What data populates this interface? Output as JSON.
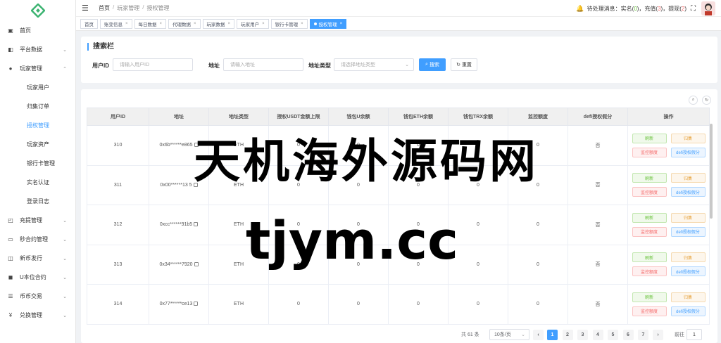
{
  "sidebar": {
    "items": [
      {
        "label": "首页",
        "icon": "dashboard-icon",
        "glyph": "▣"
      },
      {
        "label": "平台数据",
        "icon": "data-icon",
        "glyph": "◧",
        "chevron": "⌄"
      },
      {
        "label": "玩家管理",
        "icon": "user-icon",
        "glyph": "●",
        "chevron": "⌃"
      }
    ],
    "sub_items": [
      "玩家用户",
      "归集订单",
      "授权管理",
      "玩家资产",
      "银行卡管理",
      "实名认证",
      "登录日志"
    ],
    "bottom_items": [
      {
        "label": "充提管理",
        "icon": "wallet-icon",
        "glyph": "◰",
        "chevron": "⌄"
      },
      {
        "label": "秒合约管理",
        "icon": "monitor-icon",
        "glyph": "▭",
        "chevron": "⌄"
      },
      {
        "label": "新币发行",
        "icon": "coin-icon",
        "glyph": "◫",
        "chevron": "⌄"
      },
      {
        "label": "U本位合约",
        "icon": "contract-icon",
        "glyph": "◼",
        "chevron": "⌄"
      },
      {
        "label": "币币交易",
        "icon": "list-icon",
        "glyph": "☰",
        "chevron": "⌄"
      },
      {
        "label": "兑换管理",
        "icon": "yen-icon",
        "glyph": "¥",
        "chevron": "⌄"
      }
    ]
  },
  "header": {
    "breadcrumb": [
      "首页",
      "玩家管理",
      "授权管理"
    ],
    "notice_prefix": "待处理消息：实名(",
    "realname_count": "0",
    "recharge_label": ")，充值(",
    "recharge_count": "3",
    "withdraw_label": ")，提现(",
    "withdraw_count": "2",
    "notice_suffix": ")"
  },
  "tags": [
    "首页",
    "账变信息",
    "每日数据",
    "代理数据",
    "玩家数据",
    "玩家用户",
    "银行卡管理",
    "授权管理"
  ],
  "search": {
    "title": "搜索栏",
    "user_id_label": "用户ID",
    "user_id_placeholder": "请输入用户ID",
    "address_label": "地址",
    "address_placeholder": "请输入地址",
    "address_type_label": "地址类型",
    "address_type_placeholder": "请选择地址类型",
    "search_button": "搜索",
    "reset_button": "重置"
  },
  "table": {
    "headers": [
      "用户ID",
      "地址",
      "地址类型",
      "授权USDT金额上限",
      "钱包U余额",
      "钱包ETH余额",
      "钱包TRX余额",
      "监控额度",
      "defi授权假分",
      "操作"
    ],
    "rows": [
      {
        "id": "310",
        "address": "0x6b******e865",
        "type": "ETH",
        "limit": "0",
        "u": "0",
        "eth": "0",
        "trx": "0",
        "monitor": "0",
        "defi": "否"
      },
      {
        "id": "311",
        "address": "0x00******13 5",
        "type": "ETH",
        "limit": "0",
        "u": "0",
        "eth": "0",
        "trx": "0",
        "monitor": "0",
        "defi": "否"
      },
      {
        "id": "312",
        "address": "0xcc******91b5",
        "type": "ETH",
        "limit": "0",
        "u": "0",
        "eth": "0",
        "trx": "0",
        "monitor": "0",
        "defi": "否"
      },
      {
        "id": "313",
        "address": "0x34******7920",
        "type": "ETH",
        "limit": "0",
        "u": "0",
        "eth": "0",
        "trx": "0",
        "monitor": "0",
        "defi": "否"
      },
      {
        "id": "314",
        "address": "0x77******ce13",
        "type": "ETH",
        "limit": "0",
        "u": "0",
        "eth": "0",
        "trx": "0",
        "monitor": "0",
        "defi": "否"
      }
    ],
    "actions": {
      "refresh": "刷新",
      "collect": "归集",
      "monitor": "监控额度",
      "defi": "defi授权假分"
    }
  },
  "pagination": {
    "total": "共 61 条",
    "page_size": "10条/页",
    "pages": [
      "1",
      "2",
      "3",
      "4",
      "5",
      "6",
      "7"
    ],
    "prev": "‹",
    "next": "›",
    "goto_label": "前往",
    "goto_value": "1"
  },
  "watermark": {
    "line1": "天机海外源码网",
    "line2": "tjym.cc"
  },
  "colors": {
    "primary": "#409eff",
    "success": "#67c23a",
    "warning": "#e6a23c",
    "danger": "#f56c6c"
  }
}
